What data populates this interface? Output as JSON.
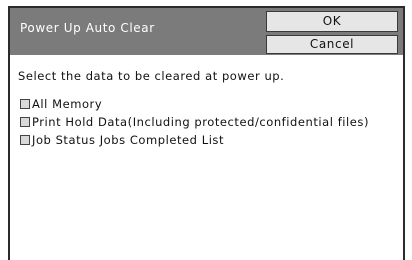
{
  "dialog": {
    "title": "Power Up Auto Clear",
    "ok_label": "OK",
    "cancel_label": "Cancel",
    "instruction": "Select the data to be cleared at power up."
  },
  "options": [
    {
      "label": "All Memory",
      "checked": false
    },
    {
      "label": "Print Hold Data(Including protected/confidential files)",
      "checked": false
    },
    {
      "label": "Job Status Jobs Completed List",
      "checked": false
    }
  ],
  "colors": {
    "titlebar": "#7b7b7b",
    "button_bg": "#e6e6e6",
    "checkbox_bg": "#d9d9d9"
  }
}
